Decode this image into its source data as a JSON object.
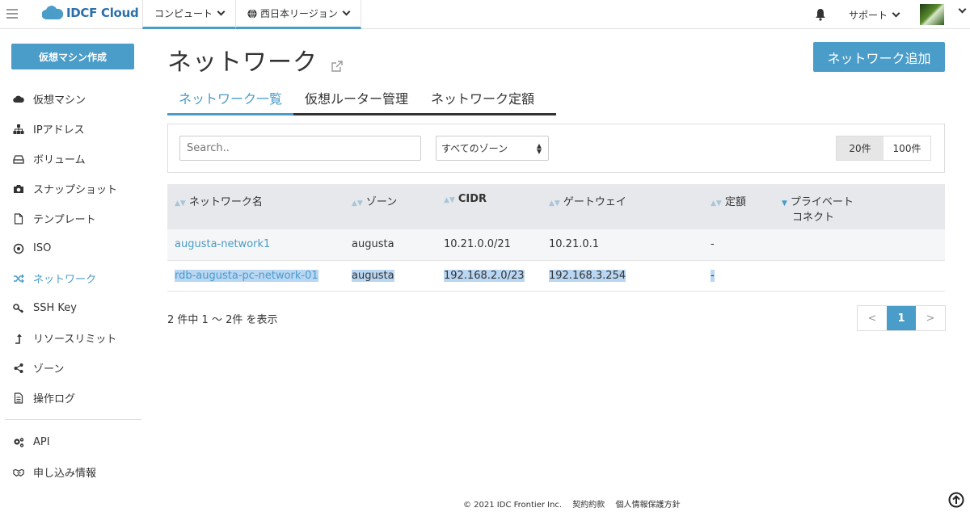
{
  "header": {
    "logo_text": "IDCF Cloud",
    "nav": [
      {
        "label": "コンピュート"
      },
      {
        "label": "西日本リージョン"
      }
    ],
    "support_label": "サポート"
  },
  "sidebar": {
    "create_button": "仮想マシン作成",
    "items": [
      {
        "label": "仮想マシン",
        "icon": "cloud-icon"
      },
      {
        "label": "IPアドレス",
        "icon": "sitemap-icon"
      },
      {
        "label": "ボリューム",
        "icon": "hdd-icon"
      },
      {
        "label": "スナップショット",
        "icon": "camera-icon"
      },
      {
        "label": "テンプレート",
        "icon": "file-icon"
      },
      {
        "label": "ISO",
        "icon": "disc-icon"
      },
      {
        "label": "ネットワーク",
        "icon": "shuffle-icon",
        "active": true
      },
      {
        "label": "SSH Key",
        "icon": "key-icon"
      },
      {
        "label": "リソースリミット",
        "icon": "level-up-icon"
      },
      {
        "label": "ゾーン",
        "icon": "share-icon"
      },
      {
        "label": "操作ログ",
        "icon": "log-icon"
      }
    ],
    "items2": [
      {
        "label": "API",
        "icon": "gears-icon"
      },
      {
        "label": "申し込み情報",
        "icon": "handshake-icon"
      }
    ]
  },
  "main": {
    "title": "ネットワーク",
    "add_button": "ネットワーク追加",
    "tabs": [
      {
        "label": "ネットワーク一覧",
        "active": true
      },
      {
        "label": "仮想ルーター管理"
      },
      {
        "label": "ネットワーク定額"
      }
    ],
    "search": {
      "placeholder": "Search.."
    },
    "zone_filter": "すべてのゾーン",
    "page_sizes": [
      "20件",
      "100件"
    ],
    "table": {
      "headers": [
        "ネットワーク名",
        "ゾーン",
        "CIDR",
        "ゲートウェイ",
        "定額",
        "プライベート",
        "コネクト"
      ],
      "rows": [
        {
          "name": "augusta-network1",
          "zone": "augusta",
          "cidr": "10.21.0.0/21",
          "gateway": "10.21.0.1",
          "flat": "-",
          "private": ""
        },
        {
          "name": "rdb-augusta-pc-network-01",
          "zone": "augusta",
          "cidr": "192.168.2.0/23",
          "gateway": "192.168.3.254",
          "flat": "-",
          "private": ""
        }
      ]
    },
    "count_text": "2 件中 1 〜 2件 を表示",
    "pager": {
      "prev": "<",
      "current": "1",
      "next": ">"
    }
  },
  "footer": {
    "copyright": "© 2021 IDC Frontier Inc.",
    "terms": "契約約款",
    "privacy": "個人情報保護方針"
  },
  "colors": {
    "accent": "#4a9cc9",
    "header_bg": "#e6e8eb",
    "selection": "#b9d6f2"
  }
}
